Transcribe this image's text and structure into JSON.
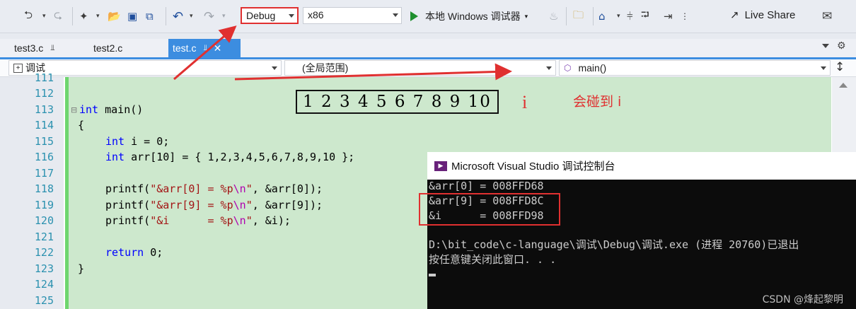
{
  "toolbar": {
    "config": "Debug",
    "platform": "x86",
    "run_label": "本地 Windows 调试器",
    "live_share": "Live Share"
  },
  "tabs": [
    {
      "label": "test3.c",
      "pinned": true
    },
    {
      "label": "test2.c",
      "pinned": false
    },
    {
      "label": "test.c",
      "pinned": true,
      "active": true
    }
  ],
  "nav": {
    "project": "调试",
    "scope": "(全局范围)",
    "member": "main()"
  },
  "editor": {
    "lines": [
      "111",
      "112",
      "113",
      "114",
      "115",
      "116",
      "117",
      "118",
      "119",
      "120",
      "121",
      "122",
      "123",
      "124",
      "125"
    ],
    "code": {
      "l113_kw": "int",
      "l113_rest": " main()",
      "l114": "{",
      "l115_kw": "int",
      "l115_rest": " i = 0;",
      "l116_kw": "int",
      "l116_rest": " arr[10] = { 1,2,3,4,5,6,7,8,9,10 };",
      "l118_fn": "printf(",
      "l118_str": "\"&arr[0] = %p",
      "l118_esc": "\\n",
      "l118_end": "\"",
      "l118_tail": ", &arr[0]);",
      "l119_fn": "printf(",
      "l119_str": "\"&arr[9] = %p",
      "l119_esc": "\\n",
      "l119_end": "\"",
      "l119_tail": ", &arr[9]);",
      "l120_fn": "printf(",
      "l120_str": "\"&i      = %p",
      "l120_esc": "\\n",
      "l120_end": "\"",
      "l120_tail": ", &i);",
      "l122_kw": "return",
      "l122_rest": " 0;",
      "l123": "}"
    }
  },
  "annotation": {
    "numbers": "1 2 3 4 5 6 7 8 9 10",
    "i_label": "i",
    "note": "会碰到 i",
    "accent": "#e03030"
  },
  "console": {
    "title": "Microsoft Visual Studio 调试控制台",
    "out1": "&arr[0] = 008FFD68",
    "out2": "&arr[9] = 008FFD8C",
    "out3": "&i      = 008FFD98",
    "exit": "D:\\bit_code\\c-language\\调试\\Debug\\调试.exe (进程 20760)已退出",
    "prompt": "按任意键关闭此窗口. . ."
  },
  "watermark": "CSDN @烽起黎明"
}
